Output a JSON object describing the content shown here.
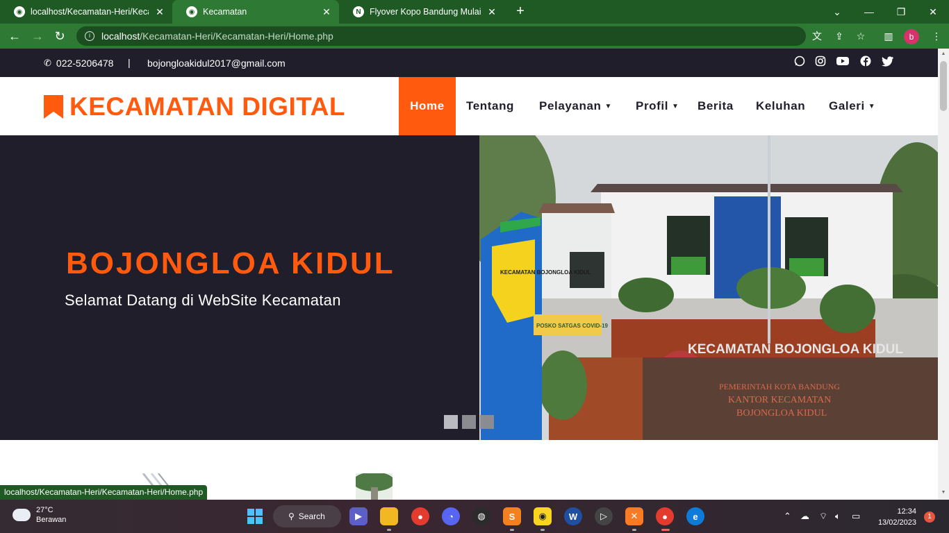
{
  "browser": {
    "tabs": [
      {
        "title": "localhost/Kecamatan-Heri/Kecam",
        "active": false
      },
      {
        "title": "Kecamatan",
        "active": true
      },
      {
        "title": "Flyover Kopo Bandung Mulai Diu",
        "active": false
      }
    ],
    "url_host": "localhost",
    "url_path": "/Kecamatan-Heri/Kecamatan-Heri/Home.php",
    "profile_initial": "b",
    "status_url": "localhost/Kecamatan-Heri/Kecamatan-Heri/Home.php"
  },
  "topbar": {
    "phone": "022-5206478",
    "separator": "|",
    "email": "bojongloakidul2017@gmail.com",
    "socials": [
      "whatsapp-icon",
      "instagram-icon",
      "youtube-icon",
      "facebook-icon",
      "twitter-icon"
    ]
  },
  "header": {
    "logo_text": "KECAMATAN DIGITAL",
    "nav": [
      {
        "label": "Home",
        "dropdown": false,
        "active": true
      },
      {
        "label": "Tentang",
        "dropdown": false,
        "active": false
      },
      {
        "label": "Pelayanan",
        "dropdown": true,
        "active": false
      },
      {
        "label": "Profil",
        "dropdown": true,
        "active": false
      },
      {
        "label": "Berita",
        "dropdown": false,
        "active": false
      },
      {
        "label": "Keluhan",
        "dropdown": false,
        "active": false
      },
      {
        "label": "Galeri",
        "dropdown": true,
        "active": false
      }
    ]
  },
  "hero": {
    "title": "BOJONGLOA KIDUL",
    "subtitle": "Selamat Datang di WebSite Kecamatan",
    "slides": 3,
    "active_slide": 0,
    "image": {
      "sign_main": "KECAMATAN BOJONGLOA KIDUL",
      "sign_line1": "PEMERINTAH KOTA BANDUNG",
      "sign_line2": "KANTOR KECAMATAN",
      "sign_line3": "BOJONGLOA KIDUL",
      "pole_sign": "KECAMATAN BOJONGLOA KIDUL",
      "banner": "POSKO SATGAS COVID-19"
    }
  },
  "taskbar": {
    "temperature": "27°C",
    "weather": "Berawan",
    "search_label": "Search",
    "time": "12:34",
    "date": "13/02/2023",
    "notifications": "1"
  },
  "colors": {
    "accent": "#ff5a0e",
    "dark": "#211e2c",
    "chrome": "#2e7a34"
  }
}
